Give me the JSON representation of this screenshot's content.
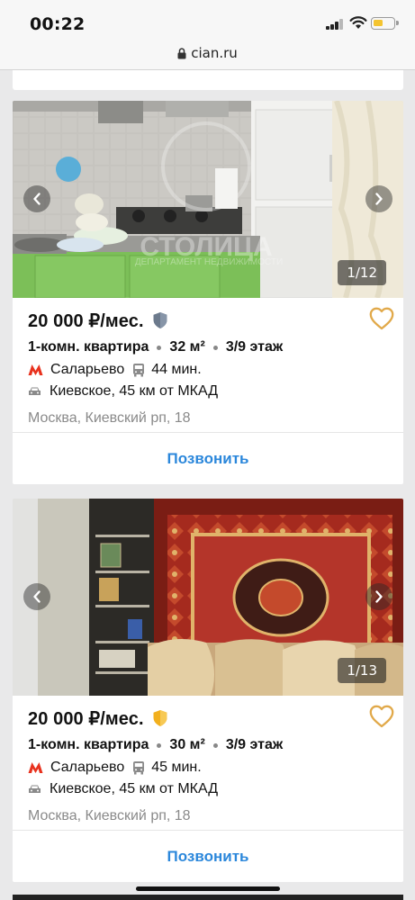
{
  "status_bar": {
    "time": "00:22"
  },
  "browser": {
    "url": "cian.ru"
  },
  "listings": [
    {
      "price": "20 000 ₽/мес.",
      "badge_color": "#6c7a8c",
      "rooms": "1-комн. квартира",
      "area": "32 м²",
      "floor": "3/9 этаж",
      "metro": "Саларьево",
      "metro_time": "44 мин.",
      "highway": "Киевское, 45 км от МКАД",
      "address": "Москва, Киевский рп, 18",
      "photo_counter": "1/12",
      "call_label": "Позвонить"
    },
    {
      "price": "20 000 ₽/мес.",
      "badge_color": "#f2b01e",
      "rooms": "1-комн. квартира",
      "area": "30 м²",
      "floor": "3/9 этаж",
      "metro": "Саларьево",
      "metro_time": "45 мин.",
      "highway": "Киевское, 45 км от МКАД",
      "address": "Москва, Киевский рп, 18",
      "photo_counter": "1/13",
      "call_label": "Позвонить"
    }
  ],
  "colors": {
    "accent": "#2b87db",
    "favorite": "#e1a94a",
    "metro": "#e8321e"
  },
  "icons": {
    "favorite": "heart-icon",
    "metro": "metro-m-icon",
    "transport": "bus-icon",
    "highway": "car-icon"
  },
  "watermark": "СТОЛИЦА ДЕПАРТАМЕНТ НЕДВИЖИМОСТИ"
}
